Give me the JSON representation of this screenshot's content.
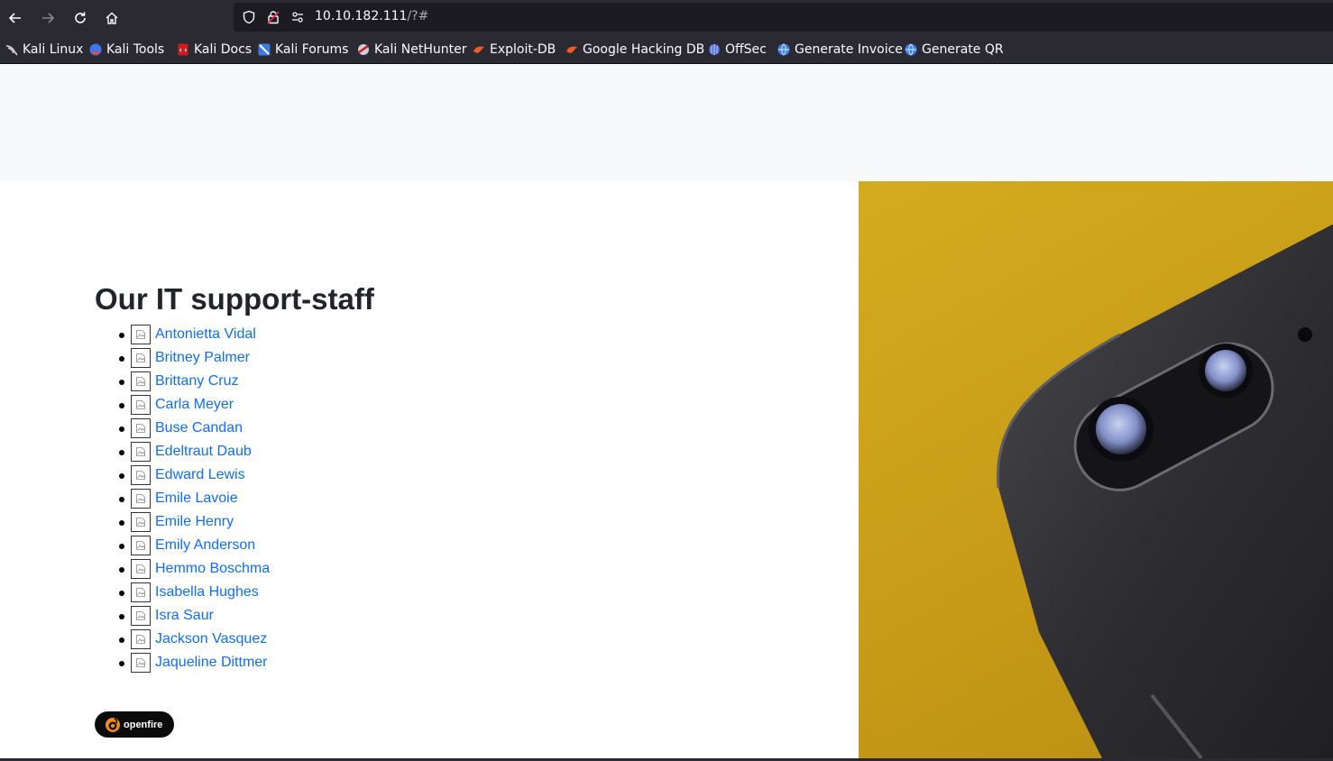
{
  "browser": {
    "url_host": "10.10.182.111",
    "url_rest": "/?#"
  },
  "bookmarks": [
    {
      "label": "Kali Linux",
      "icon": "kali-dragon-icon"
    },
    {
      "label": "Kali Tools",
      "icon": "kali-tools-icon"
    },
    {
      "label": "Kali Docs",
      "icon": "kali-docs-icon"
    },
    {
      "label": "Kali Forums",
      "icon": "kali-forums-icon"
    },
    {
      "label": "Kali NetHunter",
      "icon": "kali-nethunter-icon"
    },
    {
      "label": "Exploit-DB",
      "icon": "exploit-db-icon"
    },
    {
      "label": "Google Hacking DB",
      "icon": "ghdb-icon"
    },
    {
      "label": "OffSec",
      "icon": "offsec-icon"
    },
    {
      "label": "Generate Invoice",
      "icon": "globe-icon"
    },
    {
      "label": "Generate QR",
      "icon": "globe-icon"
    }
  ],
  "page": {
    "heading": "Our IT support-staff",
    "staff": [
      "Antonietta Vidal",
      "Britney Palmer",
      "Brittany Cruz",
      "Carla Meyer",
      "Buse Candan",
      "Edeltraut Daub",
      "Edward Lewis",
      "Emile Lavoie",
      "Emile Henry",
      "Emily Anderson",
      "Hemmo Boschma",
      "Isabella Hughes",
      "Isra Saur",
      "Jackson Vasquez",
      "Jaqueline Dittmer"
    ],
    "badge": "openfire"
  },
  "colors": {
    "link": "#0d6efd",
    "hero_background": "#d4ac1e",
    "toolbar": "#2b2a33"
  }
}
